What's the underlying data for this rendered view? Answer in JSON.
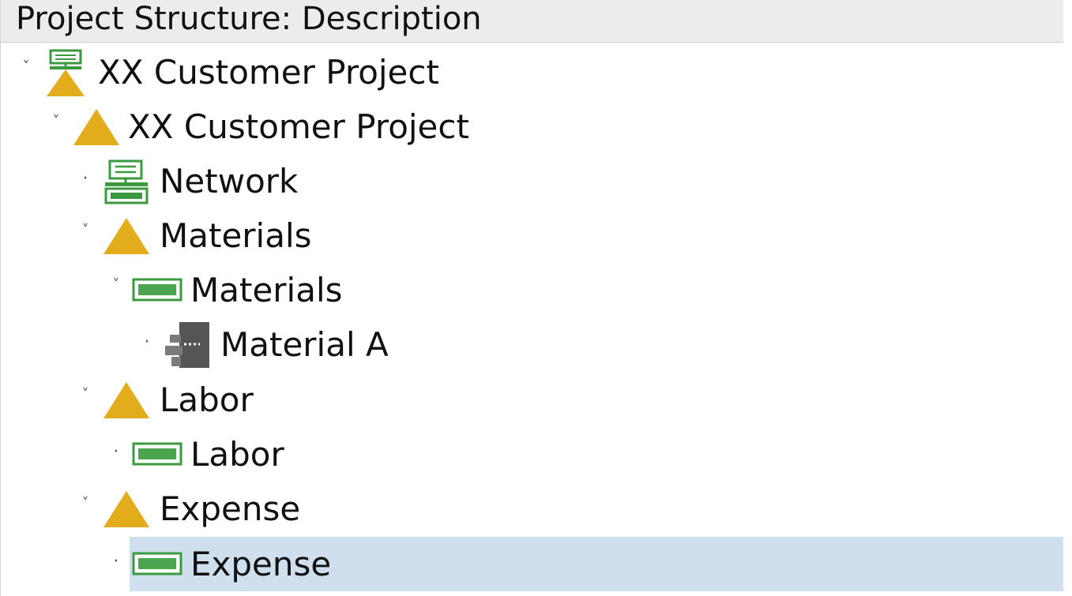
{
  "header": {
    "title": "Project Structure: Description"
  },
  "tree": {
    "rows": [
      {
        "label": "XX Customer Project",
        "icon": "project-network-triangle-icon",
        "toggle": "expanded"
      },
      {
        "label": "XX Customer Project",
        "icon": "wbs-triangle-icon",
        "toggle": "expanded"
      },
      {
        "label": "Network",
        "icon": "network-icon",
        "toggle": "leaf"
      },
      {
        "label": "Materials",
        "icon": "wbs-triangle-icon",
        "toggle": "expanded"
      },
      {
        "label": "Materials",
        "icon": "activity-bar-icon",
        "toggle": "expanded"
      },
      {
        "label": "Material A",
        "icon": "material-component-icon",
        "toggle": "leaf"
      },
      {
        "label": "Labor",
        "icon": "wbs-triangle-icon",
        "toggle": "expanded"
      },
      {
        "label": "Labor",
        "icon": "activity-bar-icon",
        "toggle": "leaf"
      },
      {
        "label": "Expense",
        "icon": "wbs-triangle-icon",
        "toggle": "expanded"
      },
      {
        "label": "Expense",
        "icon": "activity-bar-icon",
        "toggle": "leaf",
        "selected": true
      }
    ],
    "toggle_glyphs": {
      "expanded": "˅",
      "leaf": "·"
    }
  },
  "colors": {
    "wbs_triangle": "#e2ac1c",
    "network_green": "#3a9a3e",
    "activity_fill": "#4aa54e",
    "material_gray": "#555555",
    "selection": "#cfdfed",
    "header_bg": "#ececec"
  }
}
